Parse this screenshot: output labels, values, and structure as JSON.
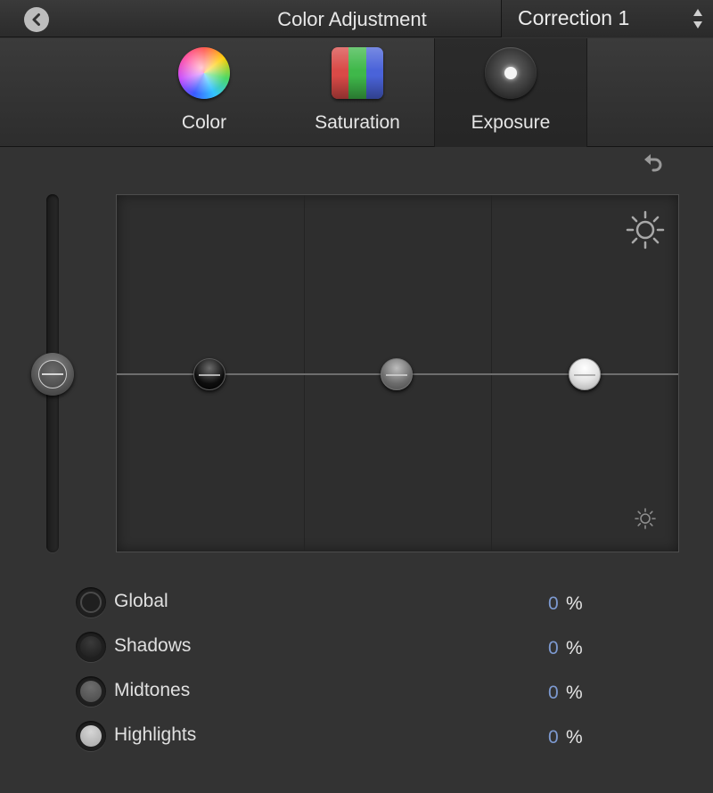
{
  "titlebar": {
    "back_icon": "chevron-left-circle-icon",
    "title": "Color Adjustment",
    "correction": "Correction 1",
    "updown_icon": "updown-arrows-icon"
  },
  "tabs": [
    {
      "label": "Color",
      "icon": "color-wheel-icon",
      "active": false
    },
    {
      "label": "Saturation",
      "icon": "saturation-icon",
      "active": false
    },
    {
      "label": "Exposure",
      "icon": "exposure-icon",
      "active": true
    }
  ],
  "reset_icon": "reset-arrow-icon",
  "graph": {
    "global_slider_value": 0,
    "pucks": {
      "shadows": 0,
      "midtones": 0,
      "highlights": 0
    },
    "bright_icon": "sun-large-icon",
    "dim_icon": "sun-small-icon"
  },
  "rows": [
    {
      "label": "Global",
      "value": "0",
      "unit": "%"
    },
    {
      "label": "Shadows",
      "value": "0",
      "unit": "%"
    },
    {
      "label": "Midtones",
      "value": "0",
      "unit": "%"
    },
    {
      "label": "Highlights",
      "value": "0",
      "unit": "%"
    }
  ],
  "colors": {
    "background": "#333333",
    "value_text": "#7d9ad1",
    "label_text": "#e0e0e0"
  }
}
